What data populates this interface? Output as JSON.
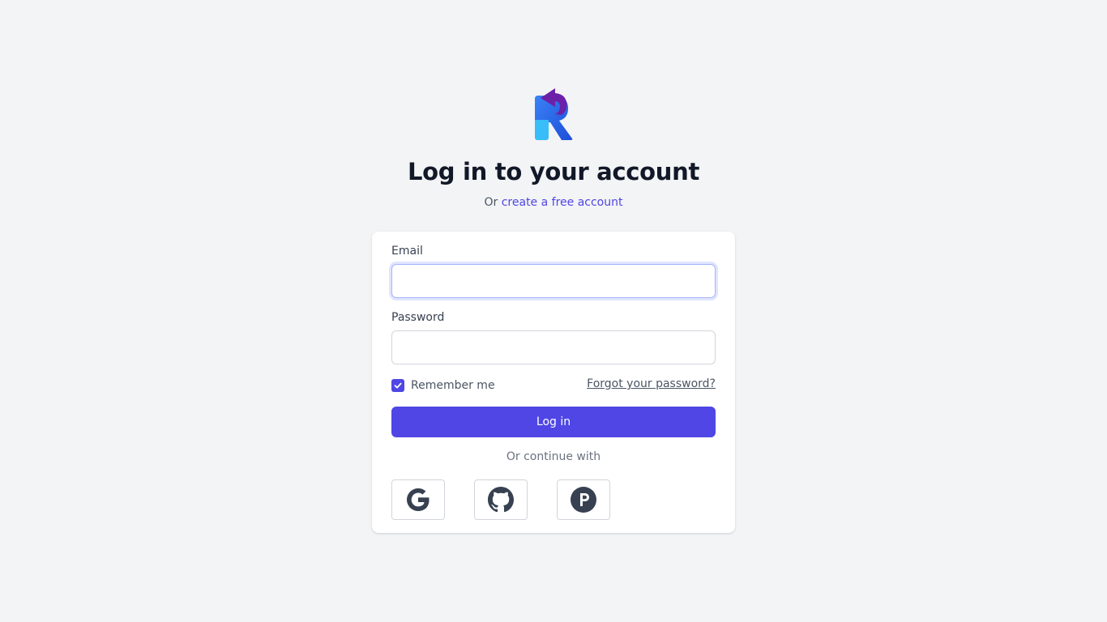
{
  "logo": {
    "icon": "app-logo-icon"
  },
  "heading": "Log in to your account",
  "subtitle": {
    "prefix": "Or",
    "link": "create a free account"
  },
  "form": {
    "email_label": "Email",
    "email_value": "",
    "password_label": "Password",
    "password_value": "",
    "remember_label": "Remember me",
    "remember_checked": true,
    "forgot_link": "Forgot your password?",
    "login_button": "Log in",
    "continue_text": "Or continue with"
  },
  "social": [
    {
      "icon": "google-icon"
    },
    {
      "icon": "github-icon"
    },
    {
      "icon": "p-icon"
    }
  ],
  "colors": {
    "background": "#f3f4f6",
    "accent": "#4f46e5",
    "card": "#ffffff"
  }
}
